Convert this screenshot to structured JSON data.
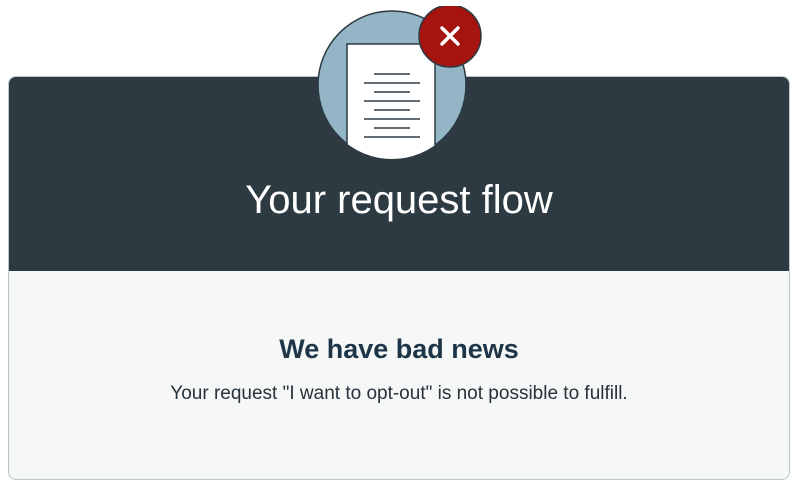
{
  "header": {
    "title": "Your request flow",
    "icon": "document-error-icon"
  },
  "content": {
    "heading": "We have bad news",
    "message": "Your request \"I want to opt-out\" is not possible to fulfill."
  },
  "colors": {
    "header_bg": "#2d3a42",
    "body_bg": "#f6f7f7",
    "icon_circle": "#93b5c5",
    "error_badge": "#a5140f",
    "heading_text": "#1e3547"
  }
}
